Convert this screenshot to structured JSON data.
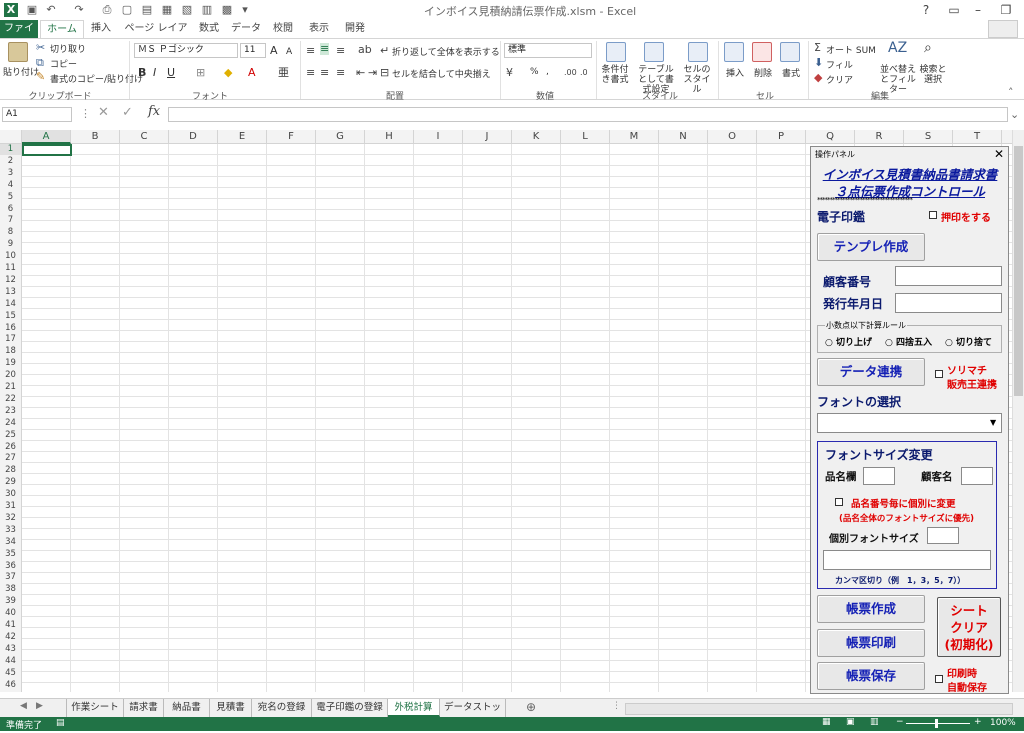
{
  "window": {
    "title": "インボイス見積納請伝票作成.xlsm - Excel"
  },
  "ribbon_tabs": [
    "ファイル",
    "ホーム",
    "挿入",
    "ページ レイアウト",
    "数式",
    "データ",
    "校閲",
    "表示",
    "開発"
  ],
  "clipboard": {
    "paste": "貼り付け",
    "cut": "切り取り",
    "copy": "コピー",
    "format_painter": "書式のコピー/貼り付け",
    "label": "クリップボード"
  },
  "font": {
    "name": "ＭＳ Ｐゴシック",
    "size": "11",
    "label": "フォント"
  },
  "alignment": {
    "wrap": "折り返して全体を表示する",
    "merge": "セルを結合して中央揃え",
    "label": "配置"
  },
  "number": {
    "format": "標準",
    "percent": "%",
    "comma": ",",
    "label": "数値"
  },
  "styles": {
    "conditional": "条件付き書式",
    "table": "テーブルとして書式設定",
    "cell": "セルのスタイル",
    "label": "スタイル"
  },
  "cells": {
    "insert": "挿入",
    "delete": "削除",
    "format": "書式",
    "label": "セル"
  },
  "editing": {
    "autosum": "オート SUM",
    "fill": "フィル",
    "clear": "クリア",
    "sort": "並べ替えとフィルター",
    "find": "検索と選択",
    "label": "編集"
  },
  "formula_bar": {
    "name_box": "A1",
    "fx": "fx",
    "value": ""
  },
  "columns": [
    "A",
    "B",
    "C",
    "D",
    "E",
    "F",
    "G",
    "H",
    "I",
    "J",
    "K",
    "L",
    "M",
    "N",
    "O",
    "P",
    "Q",
    "R",
    "S",
    "T"
  ],
  "rows": [
    "1",
    "2",
    "3",
    "4",
    "5",
    "6",
    "7",
    "8",
    "9",
    "10",
    "11",
    "12",
    "13",
    "14",
    "15",
    "16",
    "17",
    "18",
    "19",
    "20",
    "21",
    "22",
    "23",
    "24",
    "25",
    "26",
    "27",
    "28",
    "29",
    "30",
    "31",
    "32",
    "33",
    "34",
    "35",
    "36",
    "37",
    "38",
    "39",
    "40",
    "41",
    "42",
    "43",
    "44",
    "45",
    "46"
  ],
  "sheets": [
    "作業シート",
    "請求書",
    "納品書",
    "見積書",
    "宛名の登録",
    "電子印鑑の登録",
    "外税計算",
    "データストック"
  ],
  "active_sheet": "外税計算",
  "status": {
    "ready": "準備完了",
    "zoom": "100%"
  },
  "panel": {
    "title": "操作パネル",
    "heading1": "インボイス見積書納品書請求書",
    "heading2": "３点伝票作成コントロール",
    "stars": "**************************************",
    "seal_label": "電子印鑑",
    "stamp_check": "押印をする",
    "template_btn": "テンプレ作成",
    "customer_no": "顧客番号",
    "issue_date": "発行年月日",
    "rounding_group": "小数点以下計算ルール",
    "round_up": "切り上げ",
    "round_half": "四捨五入",
    "round_down": "切り捨て",
    "data_link_btn": "データ連携",
    "sorimachi_1": "ソリマチ",
    "sorimachi_2": "販売王連携",
    "font_select": "フォントの選択",
    "font_size_change": "フォントサイズ変更",
    "item_col": "品名欄",
    "customer_name": "顧客名",
    "per_item_check": "品名番号毎に個別に変更",
    "priority_note": "(品名全体のフォントサイズに優先)",
    "indiv_size": "個別フォントサイズ",
    "comma_note": "カンマ区切り（例　1，3，5，7））",
    "create_btn": "帳票作成",
    "print_btn": "帳票印刷",
    "save_btn": "帳票保存",
    "clear_btn_1": "シート",
    "clear_btn_2": "クリア",
    "clear_btn_3": "(初期化)",
    "autosave_1": "印刷時",
    "autosave_2": "自動保存"
  },
  "colors": {
    "excel_green": "#217346",
    "panel_blue": "#1521b5",
    "red": "#e00000"
  }
}
